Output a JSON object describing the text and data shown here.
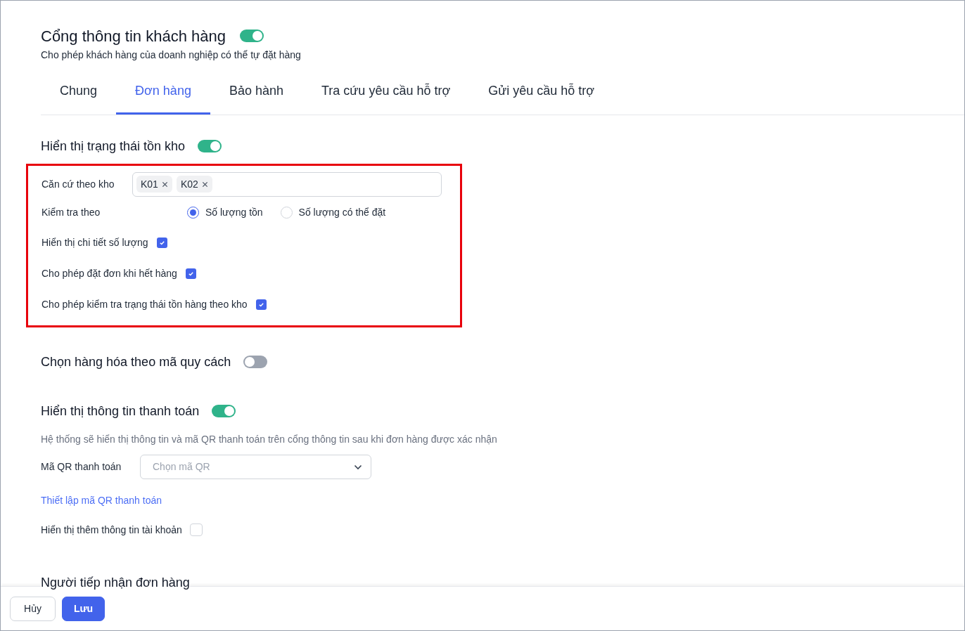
{
  "portal": {
    "title": "Cổng thông tin khách hàng",
    "on": true,
    "description": "Cho phép khách hàng của doanh nghiệp có thể tự đặt hàng"
  },
  "tabs": [
    {
      "label": "Chung",
      "selected": false
    },
    {
      "label": "Đơn hàng",
      "selected": true
    },
    {
      "label": "Bảo hành",
      "selected": false
    },
    {
      "label": "Tra cứu yêu cầu hỗ trợ",
      "selected": false
    },
    {
      "label": "Gửi yêu cầu hỗ trợ",
      "selected": false
    }
  ],
  "inventory": {
    "title": "Hiển thị trạng thái tồn kho",
    "on": true,
    "highlighted": true,
    "warehouse": {
      "label": "Căn cứ theo kho",
      "tags": [
        "K01",
        "K02"
      ]
    },
    "check_by": {
      "label": "Kiểm tra theo",
      "options": [
        {
          "label": "Số lượng tồn",
          "selected": true
        },
        {
          "label": "Số lượng có thể đặt",
          "selected": false
        }
      ]
    },
    "checkboxes": [
      {
        "label": "Hiển thị chi tiết số lượng",
        "checked": true
      },
      {
        "label": "Cho phép đặt đơn khi hết hàng",
        "checked": true
      },
      {
        "label": "Cho phép kiểm tra trạng thái tồn hàng theo kho",
        "checked": true
      }
    ]
  },
  "spec": {
    "title": "Chọn hàng hóa theo mã quy cách",
    "on": false
  },
  "payment": {
    "title": "Hiển thị thông tin thanh toán",
    "on": true,
    "note": "Hệ thống sẽ hiển thị thông tin và mã QR thanh toán trên cổng thông tin sau khi đơn hàng được xác nhận",
    "qr": {
      "label": "Mã QR thanh toán",
      "placeholder": "Chọn mã QR"
    },
    "link": "Thiết lập mã QR thanh toán",
    "checkbox": {
      "label": "Hiển thị thêm thông tin tài khoản",
      "checked": false
    }
  },
  "receiver": {
    "title": "Người tiếp nhận đơn hàng"
  },
  "buttons": [
    {
      "label": "Hủy",
      "kind": "secondary"
    },
    {
      "label": "Lưu",
      "kind": "primary"
    }
  ]
}
